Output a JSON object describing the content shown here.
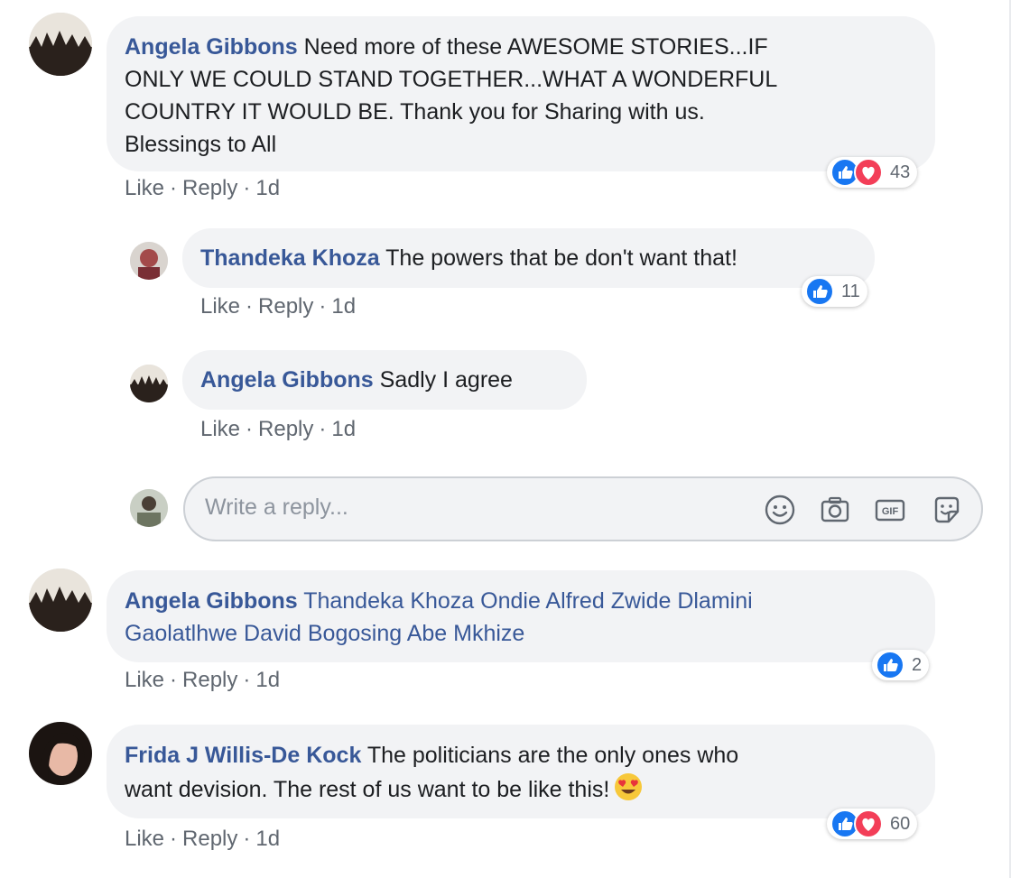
{
  "comments": [
    {
      "author": "Angela Gibbons",
      "text_line1": "Need more of these AWESOME STORIES...IF",
      "text_line2": "ONLY WE COULD STAND TOGETHER...WHAT A WONDERFUL",
      "text_line3": "COUNTRY IT WOULD BE. Thank you for Sharing with us.",
      "text_line4": "Blessings to All",
      "like": "Like",
      "reply": "Reply",
      "time": "1d",
      "reaction_count": "43",
      "replies": [
        {
          "author": "Thandeka Khoza",
          "text": "The powers that be don't want that!",
          "like": "Like",
          "reply": "Reply",
          "time": "1d",
          "reaction_count": "11"
        },
        {
          "author": "Angela Gibbons",
          "text": "Sadly I agree",
          "like": "Like",
          "reply": "Reply",
          "time": "1d"
        }
      ],
      "reply_box": {
        "placeholder": "Write a reply..."
      }
    },
    {
      "author": "Angela Gibbons",
      "tags_line1": "Thandeka Khoza Ondie Alfred Zwide Dlamini",
      "tags_line2": "Gaolatlhwe David Bogosing Abe Mkhize",
      "like": "Like",
      "reply": "Reply",
      "time": "1d",
      "reaction_count": "2"
    },
    {
      "author": "Frida J Willis-De Kock",
      "text_line1": "The politicians are the only ones who",
      "text_line2": "want devision. The rest of us want to be like this!",
      "like": "Like",
      "reply": "Reply",
      "time": "1d",
      "reaction_count": "60"
    }
  ],
  "separator": "·",
  "colors": {
    "link": "#385898",
    "like_blue": "#1877f2",
    "love_red": "#f33e58",
    "bubble_bg": "#f2f3f5",
    "meta_gray": "#606770"
  },
  "icons": {
    "reply_box_tools": [
      "emoji-icon",
      "camera-icon",
      "gif-icon",
      "sticker-icon"
    ],
    "reactions": [
      "like-reaction-icon",
      "love-reaction-icon"
    ],
    "inline_emoji": "heart-eyes-emoji"
  }
}
